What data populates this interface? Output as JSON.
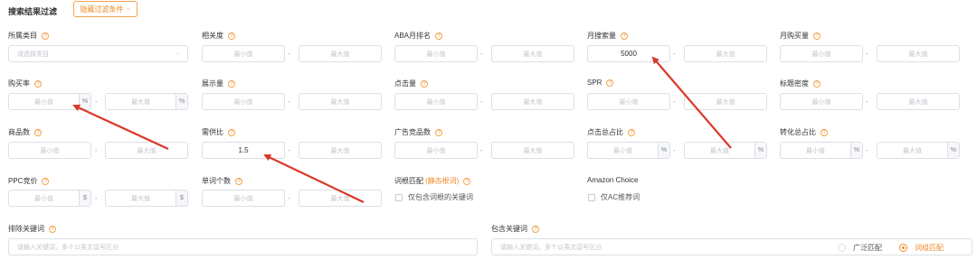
{
  "header": {
    "title": "搜索结果过滤",
    "hide_button": "隐藏过滤条件"
  },
  "placeholders": {
    "min": "最小值",
    "max": "最大值",
    "category": "请选择类目",
    "keywords": "请输入关键词，多个以英文逗号区分"
  },
  "range_sep": "-",
  "filters": {
    "category": {
      "label": "所属类目"
    },
    "relevance": {
      "label": "相关度"
    },
    "aba_rank": {
      "label": "ABA月排名"
    },
    "monthly_search": {
      "label": "月搜索量",
      "min_value": "5000"
    },
    "monthly_purchase": {
      "label": "月购买量"
    },
    "purchase_rate": {
      "label": "购买率",
      "suffix": "%"
    },
    "impressions": {
      "label": "展示量"
    },
    "clicks": {
      "label": "点击量"
    },
    "spr": {
      "label": "SPR"
    },
    "title_density": {
      "label": "标题密度"
    },
    "product_count": {
      "label": "商品数"
    },
    "supply_demand": {
      "label": "需供比",
      "min_value": "1.5"
    },
    "ad_product_count": {
      "label": "广告竞品数"
    },
    "click_share": {
      "label": "点击总占比",
      "suffix": "%"
    },
    "conversion_share": {
      "label": "转化总占比",
      "suffix": "%"
    },
    "ppc_bid": {
      "label": "PPC竞价",
      "suffix": "$"
    },
    "word_count": {
      "label": "单词个数"
    },
    "root_match": {
      "label": "词根匹配",
      "tag": "(静态根词)",
      "checkbox": "仅包含词根的关键词"
    },
    "amazon_choice": {
      "label": "Amazon Choice",
      "checkbox": "仅AC推荐词"
    },
    "exclude_keywords": {
      "label": "排除关键词"
    },
    "include_keywords": {
      "label": "包含关键词"
    }
  },
  "match_options": {
    "broad": "广泛匹配",
    "phrase": "词组匹配",
    "selected": "phrase"
  },
  "colors": {
    "accent": "#f08a24",
    "annotation_arrow": "#d9392b"
  }
}
